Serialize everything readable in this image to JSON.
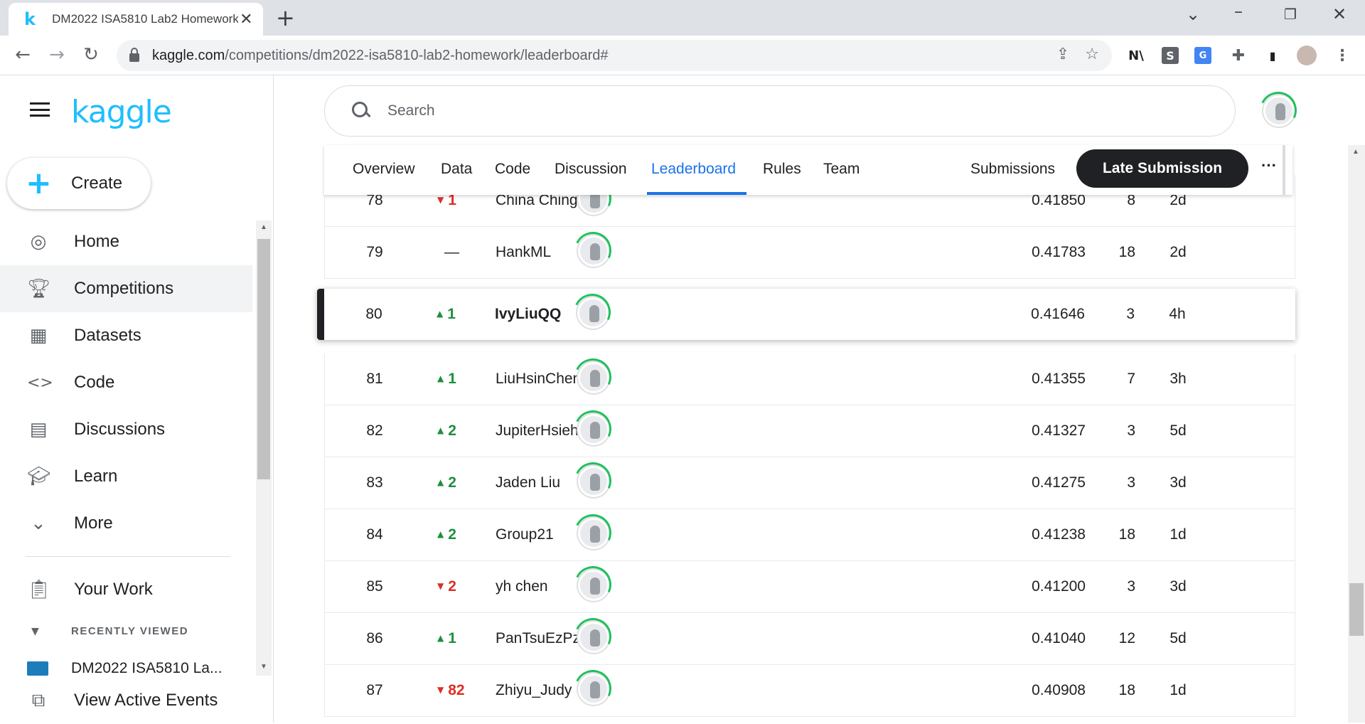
{
  "browser": {
    "tab_title": "DM2022 ISA5810 Lab2 Homework",
    "tab_favicon": "k",
    "url_domain": "kaggle.com",
    "url_path": "/competitions/dm2022-isa5810-lab2-homework/leaderboard#"
  },
  "sidebar": {
    "logo": "kaggle",
    "create_label": "Create",
    "items": [
      {
        "label": "Home",
        "icon": "compass-icon"
      },
      {
        "label": "Competitions",
        "icon": "trophy-icon"
      },
      {
        "label": "Datasets",
        "icon": "table-icon"
      },
      {
        "label": "Code",
        "icon": "code-icon"
      },
      {
        "label": "Discussions",
        "icon": "comments-icon"
      },
      {
        "label": "Learn",
        "icon": "graduation-cap-icon"
      },
      {
        "label": "More",
        "icon": "chevron-down-icon"
      }
    ],
    "your_work": "Your Work",
    "recently_viewed_label": "RECENTLY VIEWED",
    "recent_item": "DM2022 ISA5810 La...",
    "view_active_events": "View Active Events"
  },
  "search": {
    "placeholder": "Search"
  },
  "tabs": {
    "overview": "Overview",
    "data": "Data",
    "code": "Code",
    "discussion": "Discussion",
    "leaderboard": "Leaderboard",
    "rules": "Rules",
    "team": "Team",
    "submissions": "Submissions",
    "late_submission": "Late Submission",
    "more": "···"
  },
  "leaderboard": [
    {
      "rank": "78",
      "delta": "1",
      "dir": "down",
      "name": "China Ching",
      "score": "0.41850",
      "entries": "8",
      "last": "2d"
    },
    {
      "rank": "79",
      "delta": "—",
      "dir": "same",
      "name": "HankML",
      "score": "0.41783",
      "entries": "18",
      "last": "2d"
    },
    {
      "rank": "80",
      "delta": "1",
      "dir": "up",
      "name": "IvyLiuQQ",
      "score": "0.41646",
      "entries": "3",
      "last": "4h",
      "mine": true
    },
    {
      "rank": "81",
      "delta": "1",
      "dir": "up",
      "name": "LiuHsinCheng",
      "score": "0.41355",
      "entries": "7",
      "last": "3h"
    },
    {
      "rank": "82",
      "delta": "2",
      "dir": "up",
      "name": "JupiterHsieh",
      "score": "0.41327",
      "entries": "3",
      "last": "5d"
    },
    {
      "rank": "83",
      "delta": "2",
      "dir": "up",
      "name": "Jaden Liu",
      "score": "0.41275",
      "entries": "3",
      "last": "3d"
    },
    {
      "rank": "84",
      "delta": "2",
      "dir": "up",
      "name": "Group21",
      "score": "0.41238",
      "entries": "18",
      "last": "1d"
    },
    {
      "rank": "85",
      "delta": "2",
      "dir": "down",
      "name": "yh chen",
      "score": "0.41200",
      "entries": "3",
      "last": "3d"
    },
    {
      "rank": "86",
      "delta": "1",
      "dir": "up",
      "name": "PanTsuEzPz",
      "score": "0.41040",
      "entries": "12",
      "last": "5d"
    },
    {
      "rank": "87",
      "delta": "82",
      "dir": "down",
      "name": "Zhiyu_Judy",
      "score": "0.40908",
      "entries": "18",
      "last": "1d"
    }
  ],
  "colors": {
    "kaggle_blue": "#20beff",
    "active_tab": "#1a73e8",
    "up": "#1e8e3e",
    "down": "#d93025"
  }
}
